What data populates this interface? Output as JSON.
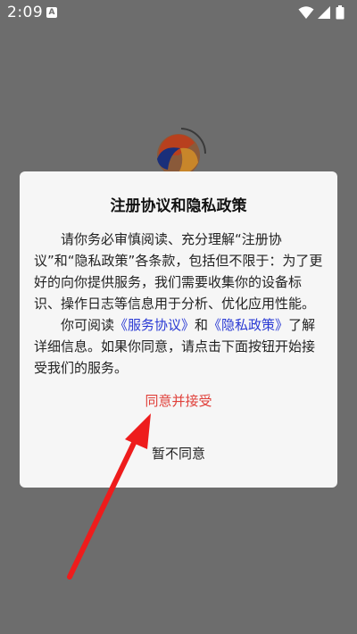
{
  "status_bar": {
    "time": "2:09",
    "notification_icon": "A"
  },
  "colors": {
    "backdrop": "#6d6d6d",
    "dialog_bg": "#f6f6f6",
    "accept": "#e0403a",
    "link": "#2a3ad4",
    "annotation_arrow": "#ee1c1c"
  },
  "icons": [
    "wifi-icon",
    "signal-icon",
    "battery-icon",
    "app-logo"
  ],
  "dialog": {
    "title": "注册协议和隐私政策",
    "paragraph1": "请你务必审慎阅读、充分理解“注册协议”和“隐私政策”各条款，包括但不限于：为了更好的向你提供服务，我们需要收集你的设备标识、操作日志等信息用于分析、优化应用性能。",
    "paragraph2_prefix": "你可阅读",
    "service_link": "《服务协议》",
    "and_text": "和",
    "privacy_link": "《隐私政策》",
    "paragraph2_suffix": "了解详细信息。如果你同意，请点击下面按钮开始接受我们的服务。",
    "accept_label": "同意并接受",
    "decline_label": "暂不同意"
  }
}
